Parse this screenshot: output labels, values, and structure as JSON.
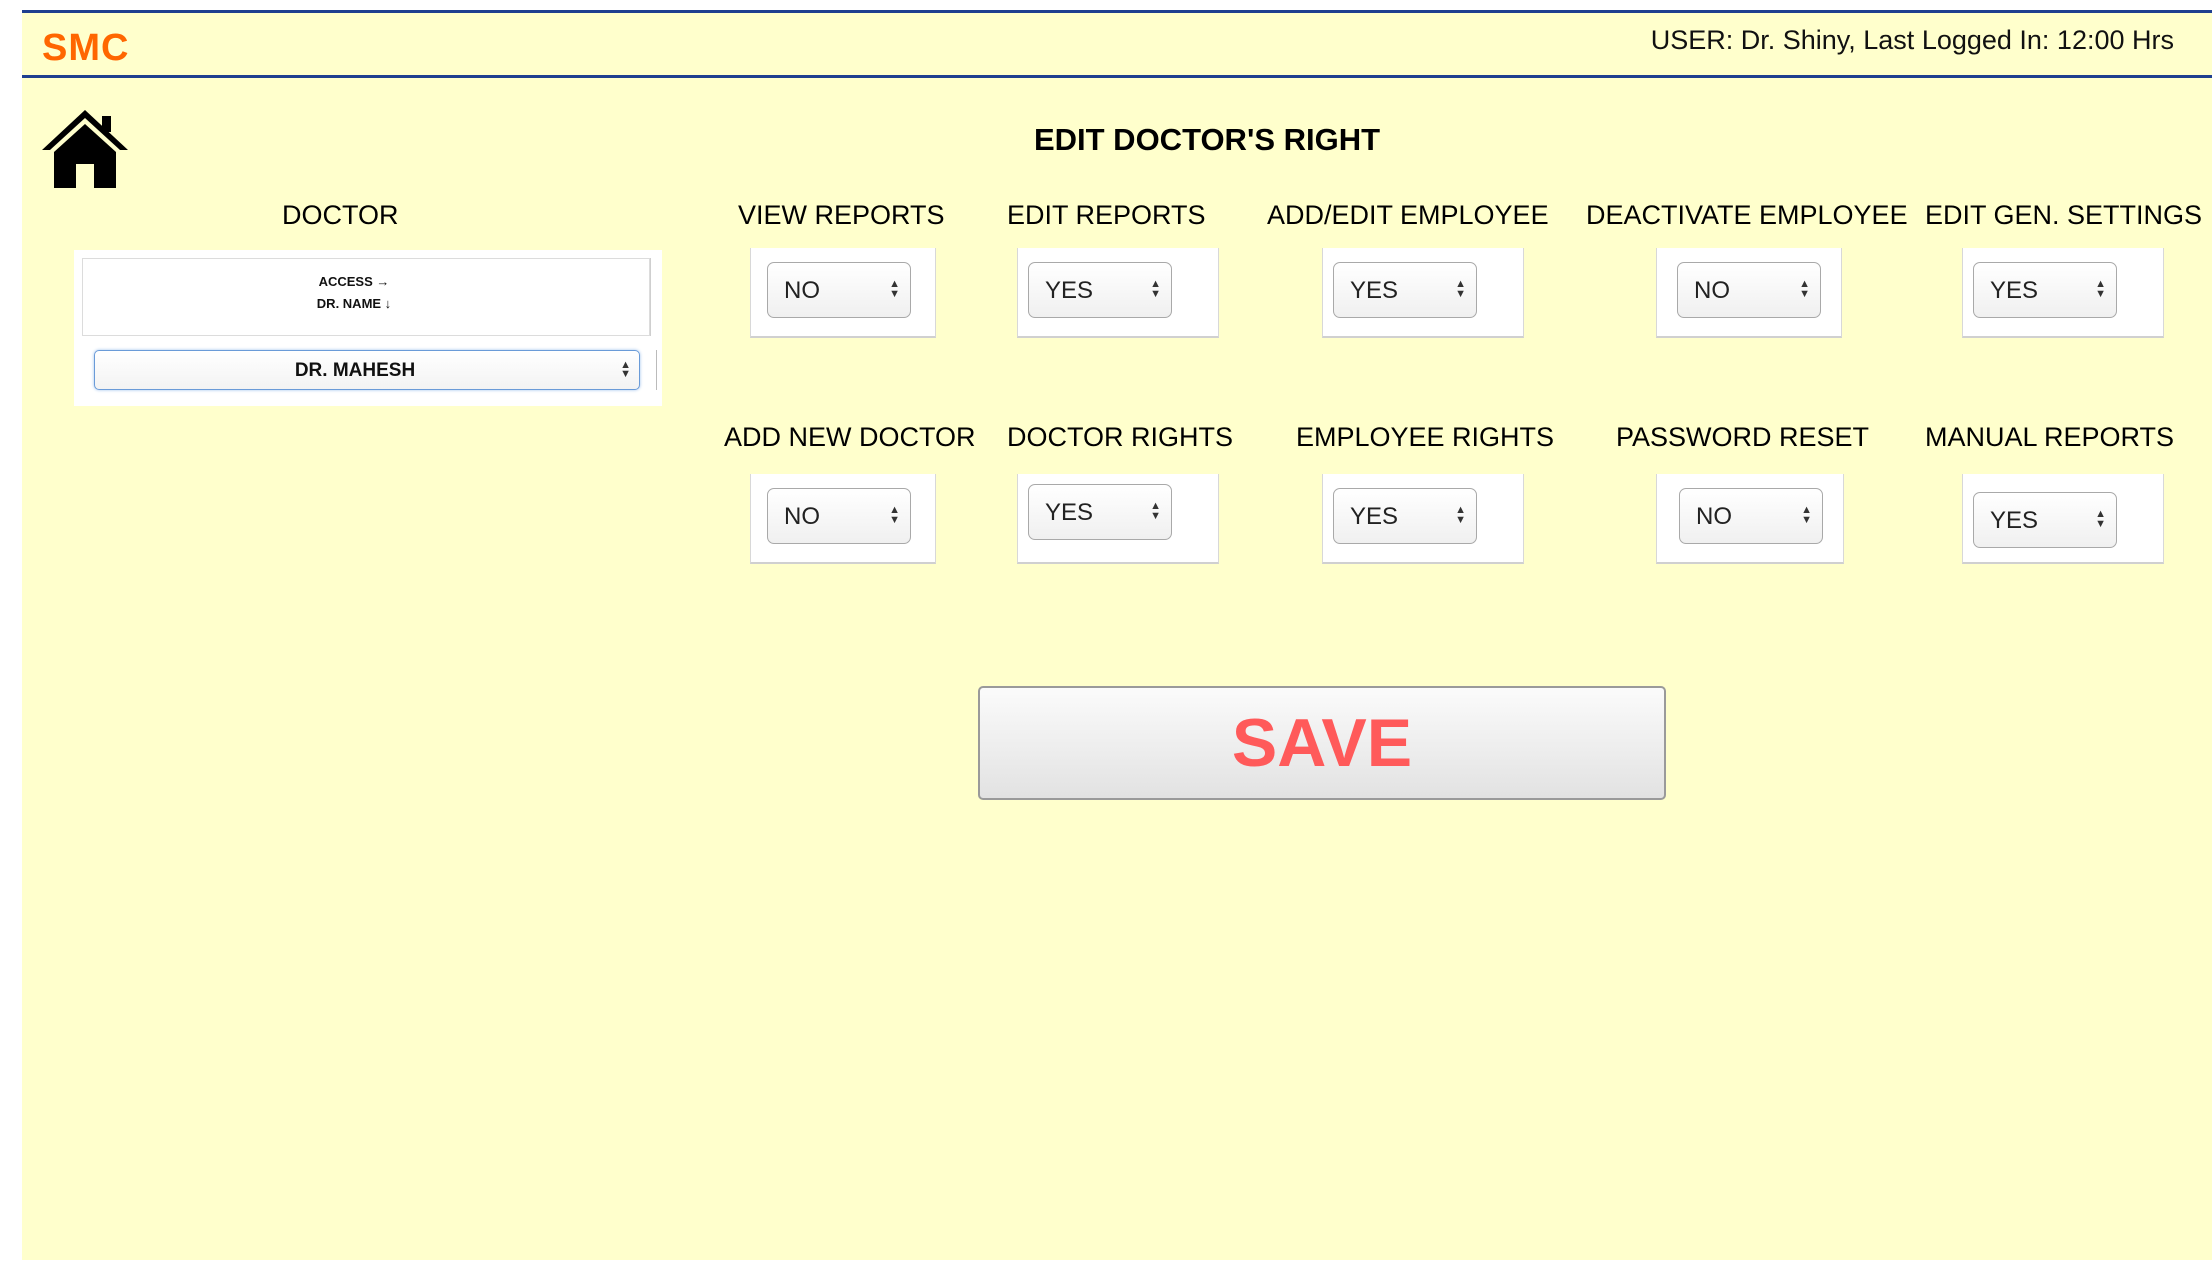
{
  "header": {
    "logo": "SMC",
    "user_info": "USER: Dr. Shiny, Last Logged In: 12:00 Hrs"
  },
  "page_title": "EDIT DOCTOR'S RIGHT",
  "doctor": {
    "label": "DOCTOR",
    "access_header": "ACCESS →",
    "name_header": "DR. NAME ↓",
    "selected": "DR.  MAHESH"
  },
  "rights_row1": [
    {
      "label": "VIEW REPORTS",
      "value": "NO"
    },
    {
      "label": "EDIT  REPORTS",
      "value": "YES"
    },
    {
      "label": "ADD/EDIT EMPLOYEE",
      "value": "YES"
    },
    {
      "label": "DEACTIVATE EMPLOYEE",
      "value": "NO"
    },
    {
      "label": "EDIT GEN. SETTINGS",
      "value": "YES"
    }
  ],
  "rights_row2": [
    {
      "label": "ADD NEW DOCTOR",
      "value": "NO"
    },
    {
      "label": "DOCTOR RIGHTS",
      "value": "YES"
    },
    {
      "label": "EMPLOYEE RIGHTS",
      "value": "YES"
    },
    {
      "label": "PASSWORD RESET",
      "value": "NO"
    },
    {
      "label": "MANUAL REPORTS",
      "value": "YES"
    }
  ],
  "save_label": "SAVE",
  "colors": {
    "background": "#ffffcc",
    "logo": "#ff6600",
    "header_border": "#1f3f8f",
    "save_text": "#ff5a5a"
  },
  "icons": {
    "home": "home-icon",
    "select_arrows": "up-down-arrows"
  }
}
